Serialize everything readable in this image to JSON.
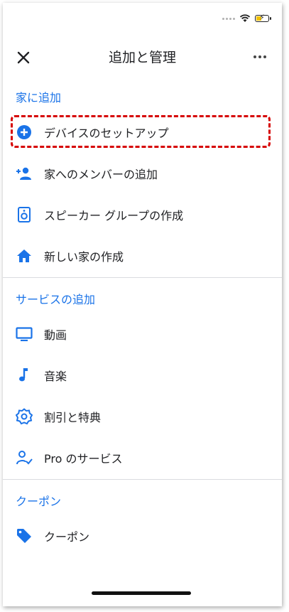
{
  "header": {
    "title": "追加と管理"
  },
  "sections": [
    {
      "title": "家に追加",
      "items": [
        {
          "label": "デバイスのセットアップ",
          "icon": "add-circle-icon"
        },
        {
          "label": "家へのメンバーの追加",
          "icon": "person-add-icon"
        },
        {
          "label": "スピーカー グループの作成",
          "icon": "speaker-icon"
        },
        {
          "label": "新しい家の作成",
          "icon": "home-icon"
        }
      ]
    },
    {
      "title": "サービスの追加",
      "items": [
        {
          "label": "動画",
          "icon": "tv-icon"
        },
        {
          "label": "音楽",
          "icon": "music-note-icon"
        },
        {
          "label": "割引と特典",
          "icon": "discount-badge-icon"
        },
        {
          "label": "Pro のサービス",
          "icon": "pro-service-icon"
        }
      ]
    },
    {
      "title": "クーポン",
      "items": [
        {
          "label": "クーポン",
          "icon": "tag-icon"
        }
      ]
    }
  ],
  "colors": {
    "accent": "#1a73e8",
    "highlight": "#d60000",
    "text": "#202124"
  }
}
